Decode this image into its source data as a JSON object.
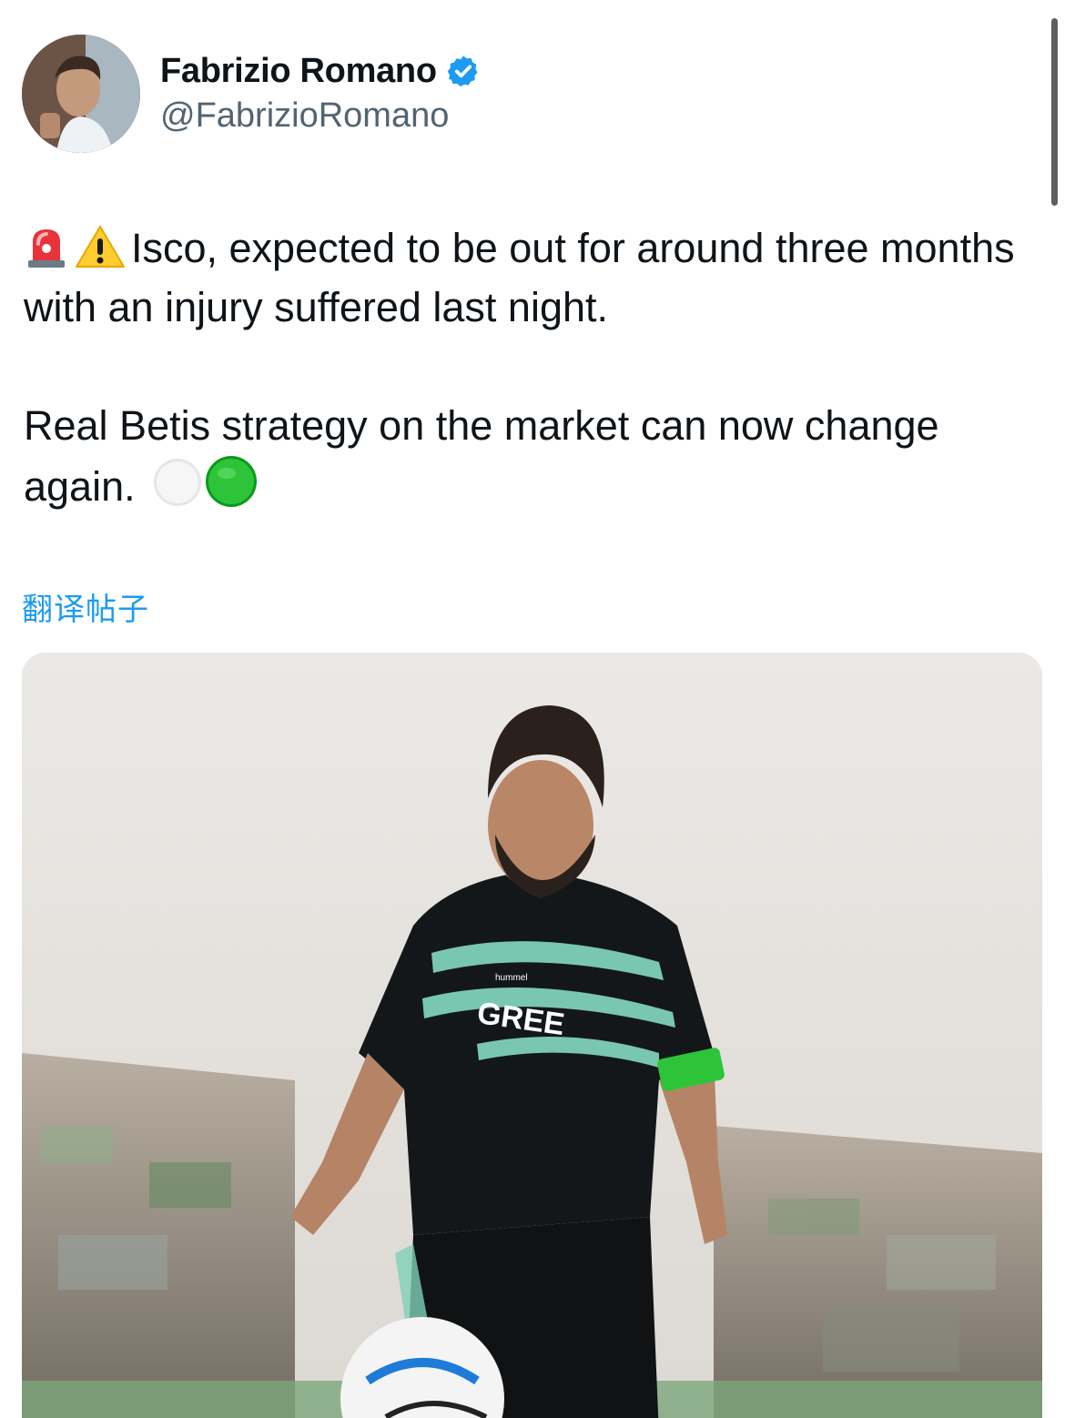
{
  "author": {
    "name": "Fabrizio Romano",
    "handle": "@FabrizioRomano",
    "verified_icon": "verified-badge-icon",
    "verified_color": "#1d9bf0"
  },
  "tweet": {
    "lead_emojis": [
      "siren-emoji",
      "warning-emoji"
    ],
    "paragraph1": "Isco, expected to be out for around three months with an injury suffered last night.",
    "paragraph2": "Real Betis strategy on the market can now change again.",
    "trail_emojis": [
      "white-circle-emoji",
      "green-circle-emoji"
    ]
  },
  "translate_link": "翻译帖子",
  "media": {
    "sponsor": "GREE",
    "kit_maker": "hummel"
  },
  "colors": {
    "link": "#1d9bf0",
    "text": "#0f1419",
    "secondary": "#536471"
  }
}
